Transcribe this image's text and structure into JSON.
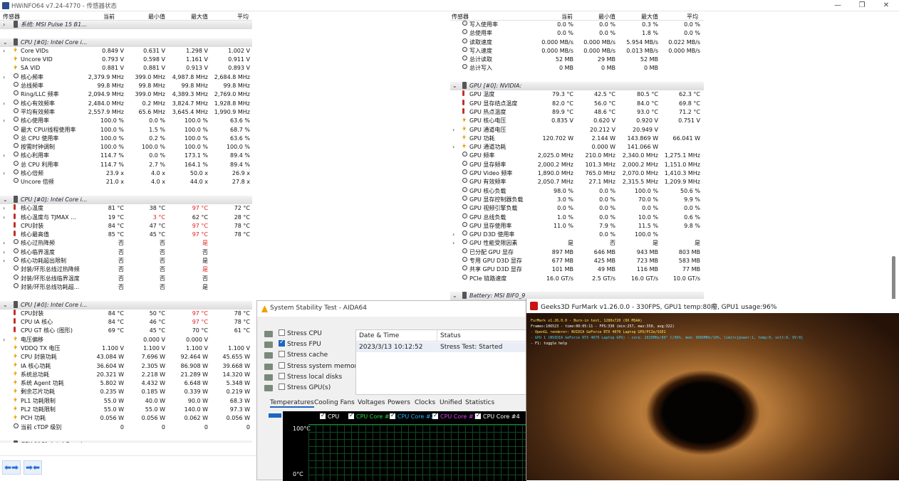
{
  "window": {
    "title": "HWiNFO64 v7.24-4770 - 传感器状态",
    "minimize": "—",
    "restore": "❐",
    "close": "✕"
  },
  "left": {
    "columns": [
      "传感器",
      "当前",
      "最小值",
      "最大值",
      "平均"
    ],
    "rows": [
      {
        "t": "grp",
        "exp": "›",
        "name": "系统: MSI Pulse 15 B1..."
      },
      {
        "t": "sp"
      },
      {
        "t": "grp",
        "exp": "⌄",
        "name": "CPU [#0]: Intel Core i..."
      },
      {
        "exp": "›",
        "icon": "volt",
        "name": "Core VIDs",
        "cur": "0.849 V",
        "min": "0.631 V",
        "max": "1.298 V",
        "avg": "1.002 V"
      },
      {
        "icon": "volt",
        "name": "Uncore VID",
        "cur": "0.793 V",
        "min": "0.598 V",
        "max": "1.161 V",
        "avg": "0.911 V"
      },
      {
        "icon": "volt",
        "name": "SA VID",
        "cur": "0.881 V",
        "min": "0.881 V",
        "max": "0.913 V",
        "avg": "0.893 V"
      },
      {
        "exp": "›",
        "icon": "clk",
        "name": "核心频率",
        "cur": "2,379.9 MHz",
        "min": "399.0 MHz",
        "max": "4,987.8 MHz",
        "avg": "2,684.8 MHz"
      },
      {
        "icon": "clk",
        "name": "总线频率",
        "cur": "99.8 MHz",
        "min": "99.8 MHz",
        "max": "99.8 MHz",
        "avg": "99.8 MHz"
      },
      {
        "icon": "clk",
        "name": "Ring/LLC 频率",
        "cur": "2,094.9 MHz",
        "min": "399.0 MHz",
        "max": "4,389.3 MHz",
        "avg": "2,769.0 MHz"
      },
      {
        "exp": "›",
        "icon": "clk",
        "name": "核心有效频率",
        "cur": "2,484.0 MHz",
        "min": "0.2 MHz",
        "max": "3,824.7 MHz",
        "avg": "1,928.8 MHz"
      },
      {
        "icon": "clk",
        "name": "平均有效频率",
        "cur": "2,557.9 MHz",
        "min": "65.6 MHz",
        "max": "3,645.4 MHz",
        "avg": "1,990.9 MHz"
      },
      {
        "exp": "›",
        "icon": "clk",
        "name": "核心使用率",
        "cur": "100.0 %",
        "min": "0.0 %",
        "max": "100.0 %",
        "avg": "63.6 %"
      },
      {
        "icon": "clk",
        "name": "最大 CPU/线程使用率",
        "cur": "100.0 %",
        "min": "1.5 %",
        "max": "100.0 %",
        "avg": "68.7 %"
      },
      {
        "icon": "clk",
        "name": "总 CPU 使用率",
        "cur": "100.0 %",
        "min": "0.2 %",
        "max": "100.0 %",
        "avg": "63.6 %"
      },
      {
        "icon": "clk",
        "name": "按需时钟调制",
        "cur": "100.0 %",
        "min": "100.0 %",
        "max": "100.0 %",
        "avg": "100.0 %"
      },
      {
        "exp": "›",
        "icon": "clk",
        "name": "核心利用率",
        "cur": "114.7 %",
        "min": "0.0 %",
        "max": "173.1 %",
        "avg": "89.4 %"
      },
      {
        "icon": "clk",
        "name": "总 CPU 利用率",
        "cur": "114.7 %",
        "min": "2.7 %",
        "max": "164.1 %",
        "avg": "89.4 %"
      },
      {
        "exp": "›",
        "icon": "clk",
        "name": "核心倍频",
        "cur": "23.9 x",
        "min": "4.0 x",
        "max": "50.0 x",
        "avg": "26.9 x"
      },
      {
        "icon": "clk",
        "name": "Uncore 倍频",
        "cur": "21.0 x",
        "min": "4.0 x",
        "max": "44.0 x",
        "avg": "27.8 x"
      },
      {
        "t": "sp"
      },
      {
        "t": "grp",
        "exp": "⌄",
        "name": "CPU [#0]: Intel Core i..."
      },
      {
        "exp": "›",
        "icon": "temp",
        "name": "核心温度",
        "cur": "81 °C",
        "min": "38 °C",
        "max": "97 °C",
        "avg": "72 °C",
        "maxRed": true
      },
      {
        "exp": "›",
        "icon": "temp",
        "name": "核心温度与 TJMAX ...",
        "cur": "19 °C",
        "min": "3 °C",
        "max": "62 °C",
        "avg": "28 °C",
        "minRed": true
      },
      {
        "icon": "temp",
        "name": "CPU封装",
        "cur": "84 °C",
        "min": "47 °C",
        "max": "97 °C",
        "avg": "78 °C",
        "maxRed": true
      },
      {
        "icon": "temp",
        "name": "核心最高值",
        "cur": "85 °C",
        "min": "45 °C",
        "max": "97 °C",
        "avg": "78 °C",
        "maxRed": true
      },
      {
        "exp": "›",
        "icon": "clk",
        "name": "核心过热降频",
        "cur": "否",
        "min": "否",
        "max": "是",
        "avg": "",
        "maxRed": true
      },
      {
        "exp": "›",
        "icon": "clk",
        "name": "核心临界温度",
        "cur": "否",
        "min": "否",
        "max": "否",
        "avg": ""
      },
      {
        "exp": "›",
        "icon": "clk",
        "name": "核心功耗超出限制",
        "cur": "否",
        "min": "否",
        "max": "是",
        "avg": ""
      },
      {
        "icon": "clk",
        "name": "封装/环形总线过热降频",
        "cur": "否",
        "min": "否",
        "max": "是",
        "avg": "",
        "maxRed": true
      },
      {
        "icon": "clk",
        "name": "封装/环形总线临界温度",
        "cur": "否",
        "min": "否",
        "max": "否",
        "avg": ""
      },
      {
        "icon": "clk",
        "name": "封装/环形总线功耗超...",
        "cur": "否",
        "min": "否",
        "max": "是",
        "avg": ""
      },
      {
        "t": "sp"
      },
      {
        "t": "grp",
        "exp": "⌄",
        "name": "CPU [#0]: Intel Core i..."
      },
      {
        "icon": "temp",
        "name": "CPU封装",
        "cur": "84 °C",
        "min": "50 °C",
        "max": "97 °C",
        "avg": "78 °C",
        "maxRed": true
      },
      {
        "icon": "temp",
        "name": "CPU IA 核心",
        "cur": "84 °C",
        "min": "46 °C",
        "max": "97 °C",
        "avg": "78 °C",
        "maxRed": true
      },
      {
        "icon": "temp",
        "name": "CPU GT 核心 (图形)",
        "cur": "69 °C",
        "min": "45 °C",
        "max": "70 °C",
        "avg": "61 °C"
      },
      {
        "exp": "›",
        "icon": "volt",
        "name": "电压偏移",
        "cur": "",
        "min": "0.000 V",
        "max": "0.000 V",
        "avg": ""
      },
      {
        "icon": "volt",
        "name": "VDDQ TX 电压",
        "cur": "1.100 V",
        "min": "1.100 V",
        "max": "1.100 V",
        "avg": "1.100 V"
      },
      {
        "icon": "pwr",
        "name": "CPU 封装功耗",
        "cur": "43.084 W",
        "min": "7.696 W",
        "max": "92.464 W",
        "avg": "45.655 W"
      },
      {
        "icon": "pwr",
        "name": "IA 核心功耗",
        "cur": "36.604 W",
        "min": "2.305 W",
        "max": "86.908 W",
        "avg": "39.668 W"
      },
      {
        "icon": "pwr",
        "name": "系统总功耗",
        "cur": "20.321 W",
        "min": "2.218 W",
        "max": "21.289 W",
        "avg": "14.320 W"
      },
      {
        "icon": "pwr",
        "name": "系统 Agent 功耗",
        "cur": "5.802 W",
        "min": "4.432 W",
        "max": "6.648 W",
        "avg": "5.348 W"
      },
      {
        "icon": "pwr",
        "name": "剩余芯片功耗",
        "cur": "0.235 W",
        "min": "0.185 W",
        "max": "0.339 W",
        "avg": "0.219 W"
      },
      {
        "icon": "pwr",
        "name": "PL1 功耗限制",
        "cur": "55.0 W",
        "min": "40.0 W",
        "max": "90.0 W",
        "avg": "68.3 W"
      },
      {
        "icon": "pwr",
        "name": "PL2 功耗限制",
        "cur": "55.0 W",
        "min": "55.0 W",
        "max": "140.0 W",
        "avg": "97.3 W"
      },
      {
        "icon": "pwr",
        "name": "PCH 功耗",
        "cur": "0.056 W",
        "min": "0.056 W",
        "max": "0.062 W",
        "avg": "0.056 W"
      },
      {
        "icon": "clk",
        "name": "当前 cTDP 级别",
        "cur": "0",
        "min": "0",
        "max": "0",
        "avg": "0"
      },
      {
        "t": "sp"
      },
      {
        "t": "grp",
        "exp": "⌄",
        "name": "CPU [#0]: Intel Core i..."
      }
    ]
  },
  "right": {
    "columns": [
      "传感器",
      "当前",
      "最小值",
      "最大值",
      "平均"
    ],
    "rows": [
      {
        "icon": "clk",
        "name": "写入使用率",
        "cur": "0.0 %",
        "min": "0.0 %",
        "max": "0.3 %",
        "avg": "0.0 %"
      },
      {
        "icon": "clk",
        "name": "总使用率",
        "cur": "0.0 %",
        "min": "0.0 %",
        "max": "1.8 %",
        "avg": "0.0 %"
      },
      {
        "icon": "clk",
        "name": "读取速度",
        "cur": "0.000 MB/s",
        "min": "0.000 MB/s",
        "max": "5.954 MB/s",
        "avg": "0.022 MB/s"
      },
      {
        "icon": "clk",
        "name": "写入速度",
        "cur": "0.000 MB/s",
        "min": "0.000 MB/s",
        "max": "0.013 MB/s",
        "avg": "0.000 MB/s"
      },
      {
        "icon": "clk",
        "name": "总计读取",
        "cur": "52 MB",
        "min": "29 MB",
        "max": "52 MB",
        "avg": ""
      },
      {
        "icon": "clk",
        "name": "总计写入",
        "cur": "0 MB",
        "min": "0 MB",
        "max": "0 MB",
        "avg": ""
      },
      {
        "t": "sp"
      },
      {
        "t": "grp",
        "exp": "⌄",
        "name": "GPU [#0]: NVIDIA:"
      },
      {
        "icon": "temp",
        "name": "GPU 温度",
        "cur": "79.3 °C",
        "min": "42.5 °C",
        "max": "80.5 °C",
        "avg": "62.3 °C"
      },
      {
        "icon": "temp",
        "name": "GPU 显存结点温度",
        "cur": "82.0 °C",
        "min": "56.0 °C",
        "max": "84.0 °C",
        "avg": "69.8 °C"
      },
      {
        "icon": "temp",
        "name": "GPU 热点温度",
        "cur": "89.9 °C",
        "min": "48.6 °C",
        "max": "93.0 °C",
        "avg": "71.2 °C"
      },
      {
        "icon": "volt",
        "name": "GPU 核心电压",
        "cur": "0.835 V",
        "min": "0.620 V",
        "max": "0.920 V",
        "avg": "0.751 V"
      },
      {
        "exp": "›",
        "icon": "volt",
        "name": "GPU 通道电压",
        "cur": "",
        "min": "20.212 V",
        "max": "20.949 V",
        "avg": ""
      },
      {
        "icon": "pwr",
        "name": "GPU 功耗",
        "cur": "120.702 W",
        "min": "2.144 W",
        "max": "143.869 W",
        "avg": "66.041 W"
      },
      {
        "exp": "›",
        "icon": "pwr",
        "name": "GPU 通道功耗",
        "cur": "",
        "min": "0.000 W",
        "max": "141.066 W",
        "avg": ""
      },
      {
        "icon": "clk",
        "name": "GPU 频率",
        "cur": "2,025.0 MHz",
        "min": "210.0 MHz",
        "max": "2,340.0 MHz",
        "avg": "1,275.1 MHz"
      },
      {
        "icon": "clk",
        "name": "GPU 显存频率",
        "cur": "2,000.2 MHz",
        "min": "101.3 MHz",
        "max": "2,000.2 MHz",
        "avg": "1,151.0 MHz"
      },
      {
        "icon": "clk",
        "name": "GPU Video 频率",
        "cur": "1,890.0 MHz",
        "min": "765.0 MHz",
        "max": "2,070.0 MHz",
        "avg": "1,410.3 MHz"
      },
      {
        "icon": "clk",
        "name": "GPU 有效频率",
        "cur": "2,050.7 MHz",
        "min": "27.1 MHz",
        "max": "2,315.5 MHz",
        "avg": "1,209.9 MHz"
      },
      {
        "icon": "clk",
        "name": "GPU 核心负载",
        "cur": "98.0 %",
        "min": "0.0 %",
        "max": "100.0 %",
        "avg": "50.6 %"
      },
      {
        "icon": "clk",
        "name": "GPU 显存控制器负载",
        "cur": "3.0 %",
        "min": "0.0 %",
        "max": "70.0 %",
        "avg": "9.9 %"
      },
      {
        "icon": "clk",
        "name": "GPU 视频引擎负载",
        "cur": "0.0 %",
        "min": "0.0 %",
        "max": "0.0 %",
        "avg": "0.0 %"
      },
      {
        "icon": "clk",
        "name": "GPU 总线负载",
        "cur": "1.0 %",
        "min": "0.0 %",
        "max": "10.0 %",
        "avg": "0.6 %"
      },
      {
        "icon": "clk",
        "name": "GPU 显存使用率",
        "cur": "11.0 %",
        "min": "7.9 %",
        "max": "11.5 %",
        "avg": "9.8 %"
      },
      {
        "exp": "›",
        "icon": "clk",
        "name": "GPU D3D 使用率",
        "cur": "",
        "min": "0.0 %",
        "max": "100.0 %",
        "avg": ""
      },
      {
        "exp": "›",
        "icon": "clk",
        "name": "GPU 性能受限因素",
        "cur": "是",
        "min": "否",
        "max": "是",
        "avg": "是"
      },
      {
        "icon": "clk",
        "name": "已分配 GPU 显存",
        "cur": "897 MB",
        "min": "646 MB",
        "max": "943 MB",
        "avg": "803 MB"
      },
      {
        "icon": "clk",
        "name": "专用 GPU D3D 显存",
        "cur": "677 MB",
        "min": "425 MB",
        "max": "723 MB",
        "avg": "583 MB"
      },
      {
        "icon": "clk",
        "name": "共享 GPU D3D 显存",
        "cur": "101 MB",
        "min": "49 MB",
        "max": "116 MB",
        "avg": "77 MB"
      },
      {
        "icon": "clk",
        "name": "PCIe 链路速度",
        "cur": "16.0 GT/s",
        "min": "2.5 GT/s",
        "max": "16.0 GT/s",
        "avg": "10.0 GT/s"
      },
      {
        "t": "sp"
      },
      {
        "t": "grp",
        "exp": "⌄",
        "name": "Battery: MSI BIF0_9"
      }
    ]
  },
  "bottom": {
    "btn1": "⬅➡",
    "btn2": "➡⬅"
  },
  "aida": {
    "title": "System Stability Test - AIDA64",
    "checks": [
      {
        "label": "Stress CPU",
        "on": false
      },
      {
        "label": "Stress FPU",
        "on": true
      },
      {
        "label": "Stress cache",
        "on": false
      },
      {
        "label": "Stress system memory",
        "on": false
      },
      {
        "label": "Stress local disks",
        "on": false
      },
      {
        "label": "Stress GPU(s)",
        "on": false
      }
    ],
    "log_cols": [
      "Date & Time",
      "Status"
    ],
    "log_row": [
      "2023/3/13 10:12:52",
      "Stress Test: Started"
    ],
    "tabs": [
      "Temperatures",
      "Cooling Fans",
      "Voltages",
      "Powers",
      "Clocks",
      "Unified",
      "Statistics"
    ],
    "legend": [
      {
        "label": "CPU",
        "color": "#ffffff"
      },
      {
        "label": "CPU Core #1",
        "color": "#22e04a"
      },
      {
        "label": "CPU Core #2",
        "color": "#25b4ff"
      },
      {
        "label": "CPU Core #3",
        "color": "#e040fb"
      },
      {
        "label": "CPU Core #4",
        "color": "#ffffff"
      }
    ],
    "axis_top": "100°C",
    "axis_bottom": "0°C"
  },
  "furmark": {
    "title": "Geeks3D FurMark v1.26.0.0 - 330FPS, GPU1 temp:80癈, GPU1 usage:96%",
    "overlay": [
      {
        "text": "FurMark v1.26.0.0 - Burn-in test, 1280x720 (0X MSAA)",
        "color": "#ffe94a"
      },
      {
        "text": "Frames:106523 - time:00:05:11 - FPS:330 (min:257, max:350, avg:322)",
        "color": "#ffffff"
      },
      {
        "text": "- OpenGL renderer: NVIDIA GeForce RTX 4070 Laptop GPU/PCIe/SSE2",
        "color": "#ffe94a"
      },
      {
        "text": "- GPU 1 (NVIDIA GeForce RTX 4070 Laptop GPU) - core: 2025MHz/80° C/96%, mem: 8000MHz/10%, limits[power:1, temp:0, volt:0, OV:0]",
        "color": "#3ed2ff"
      },
      {
        "text": "- F1: toggle help",
        "color": "#ffffff"
      }
    ]
  }
}
